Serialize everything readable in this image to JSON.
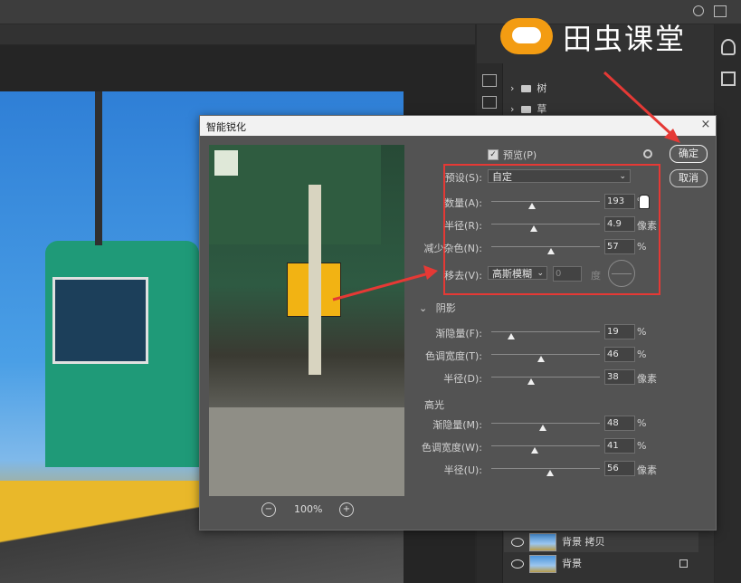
{
  "watermark": {
    "text": "田虫课堂"
  },
  "dialog": {
    "title": "智能锐化",
    "close": "×",
    "preview_label": "预览(P)",
    "ok": "确定",
    "cancel": "取消",
    "zoom": "100%",
    "zoom_out": "−",
    "zoom_in": "+",
    "preset": {
      "label": "预设(S):",
      "value": "自定"
    },
    "amount": {
      "label": "数量(A):",
      "value": "193",
      "unit": "%",
      "level": 0.39
    },
    "radius": {
      "label": "半径(R):",
      "value": "4.9",
      "unit": "像素",
      "level": 0.4
    },
    "noise": {
      "label": "减少杂色(N):",
      "value": "57",
      "unit": "%",
      "level": 0.57
    },
    "remove": {
      "label": "移去(V):",
      "value": "高斯模糊",
      "angle": "0",
      "angle_unit": "度"
    },
    "shadows": {
      "header": "阴影",
      "fade": {
        "label": "渐隐量(F):",
        "value": "19",
        "unit": "%",
        "level": 0.19
      },
      "tonal": {
        "label": "色调宽度(T):",
        "value": "46",
        "unit": "%",
        "level": 0.46
      },
      "radius": {
        "label": "半径(D):",
        "value": "38",
        "unit": "像素",
        "level": 0.38
      }
    },
    "highlights": {
      "header": "高光",
      "fade": {
        "label": "渐隐量(M):",
        "value": "48",
        "unit": "%",
        "level": 0.48
      },
      "tonal": {
        "label": "色调宽度(W):",
        "value": "41",
        "unit": "%",
        "level": 0.41
      },
      "radius": {
        "label": "半径(U):",
        "value": "56",
        "unit": "像素",
        "level": 0.56
      }
    }
  },
  "layers_panel": {
    "groups": [
      "树",
      "草"
    ],
    "layers": [
      "背景 拷贝",
      "背景"
    ]
  },
  "colors": {
    "annotation_red": "#e53935",
    "dialog_bg": "#535353"
  }
}
